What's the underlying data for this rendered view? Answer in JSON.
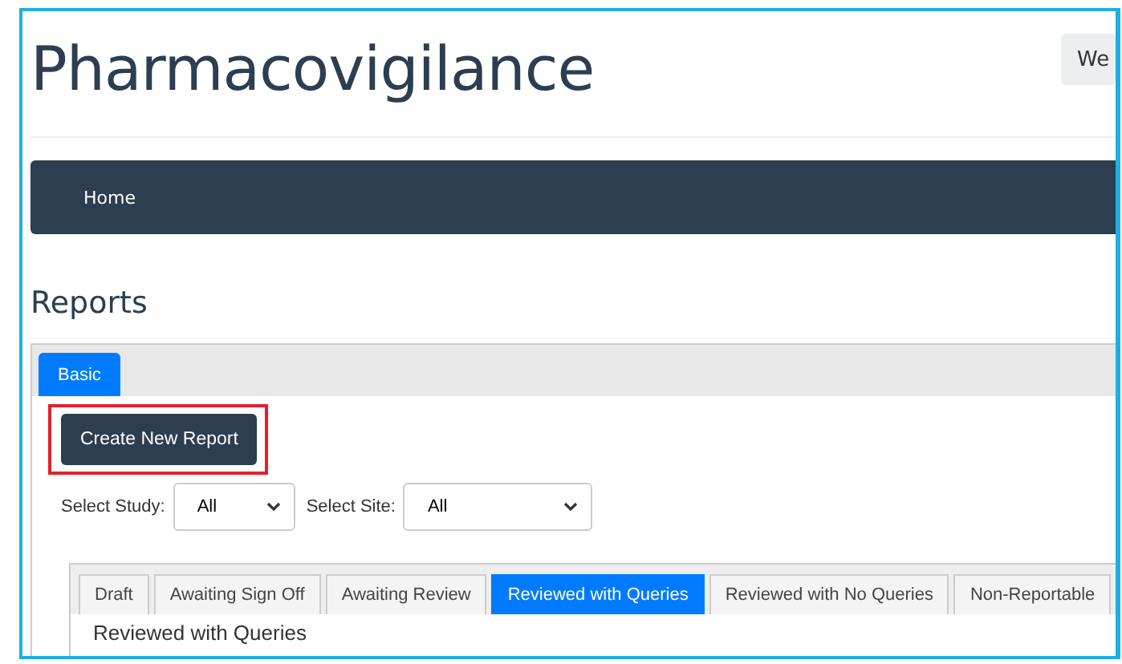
{
  "header": {
    "title": "Pharmacovigilance",
    "user_button": "We"
  },
  "navbar": {
    "items": [
      {
        "label": "Home"
      }
    ]
  },
  "page_title": "Reports",
  "panel_tabs": [
    {
      "label": "Basic",
      "selected": true
    }
  ],
  "create_button": "Create New Report",
  "filters": [
    {
      "label": "Select Study:",
      "value": "All"
    },
    {
      "label": "Select Site:",
      "value": "All"
    }
  ],
  "status_tabs": [
    {
      "label": "Draft",
      "selected": false
    },
    {
      "label": "Awaiting Sign Off",
      "selected": false
    },
    {
      "label": "Awaiting Review",
      "selected": false
    },
    {
      "label": "Reviewed with Queries",
      "selected": true
    },
    {
      "label": "Reviewed with No Queries",
      "selected": false
    },
    {
      "label": "Non-Reportable",
      "selected": false
    }
  ],
  "section_title": "Reviewed with Queries"
}
